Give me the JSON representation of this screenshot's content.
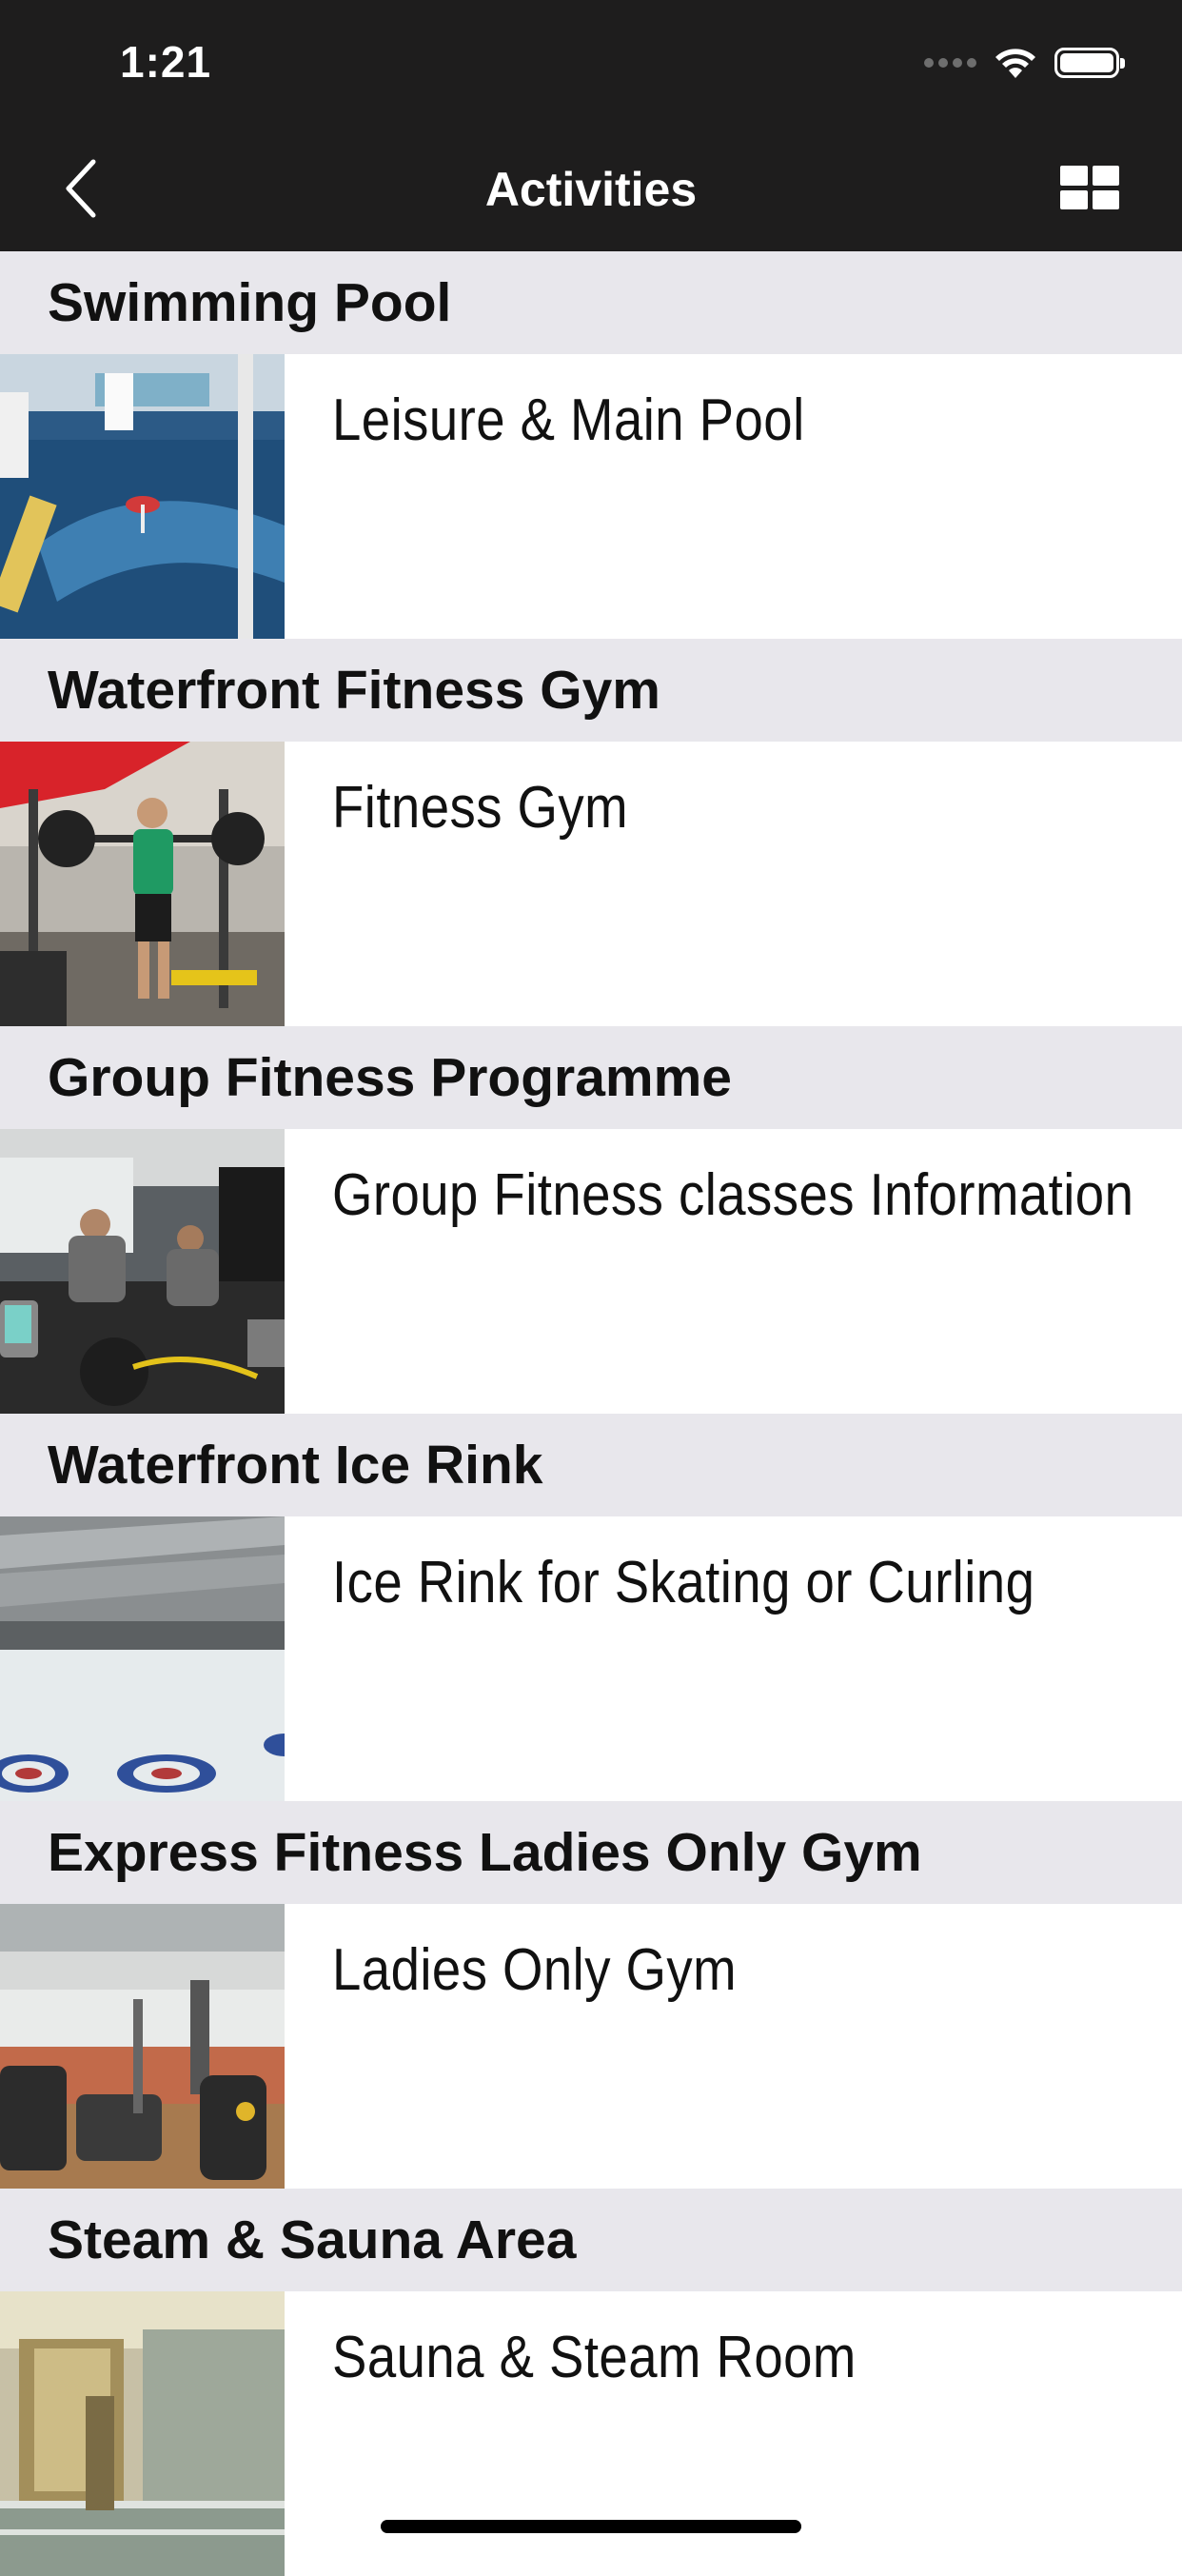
{
  "status_bar": {
    "time": "1:21"
  },
  "nav": {
    "title": "Activities"
  },
  "sections": [
    {
      "header": "Swimming Pool",
      "item": "Leisure & Main Pool"
    },
    {
      "header": "Waterfront Fitness Gym",
      "item": "Fitness Gym"
    },
    {
      "header": "Group Fitness Programme",
      "item": "Group Fitness classes Information"
    },
    {
      "header": "Waterfront Ice Rink",
      "item": "Ice Rink for Skating or Curling"
    },
    {
      "header": "Express Fitness Ladies Only Gym",
      "item": "Ladies Only Gym"
    },
    {
      "header": "Steam & Sauna Area",
      "item": "Sauna & Steam Room"
    }
  ],
  "icons": {
    "back": "chevron-left-icon",
    "view_toggle": "grid-icon",
    "wifi": "wifi-icon",
    "battery": "battery-icon"
  },
  "colors": {
    "bar_background": "#1e1d1d",
    "section_header_background": "#e8e7ec"
  }
}
